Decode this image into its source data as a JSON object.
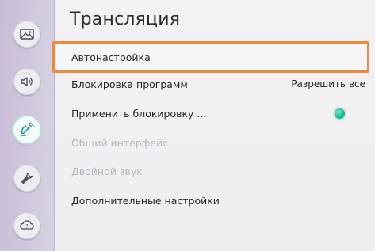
{
  "header": {
    "title": "Трансляция"
  },
  "sidebar": {
    "items": [
      {
        "icon": "picture-icon"
      },
      {
        "icon": "sound-icon"
      },
      {
        "icon": "broadcast-icon",
        "active": true
      },
      {
        "icon": "wrench-icon"
      },
      {
        "icon": "support-icon"
      }
    ]
  },
  "menu": {
    "items": [
      {
        "label": "Автонастройка",
        "focused": true
      },
      {
        "label": "Блокировка программ",
        "value": "Разрешить все"
      },
      {
        "label": "Применить блокировку ...",
        "toggle": "on"
      },
      {
        "label": "Общий интерфейс",
        "disabled": true
      },
      {
        "label": "Двойной звук",
        "disabled": true
      },
      {
        "label": "Дополнительные настройки"
      }
    ]
  },
  "colors": {
    "focus_border": "#f08a3a",
    "toggle_on": "#1fb79a",
    "disabled_text": "#b9b7bf"
  }
}
